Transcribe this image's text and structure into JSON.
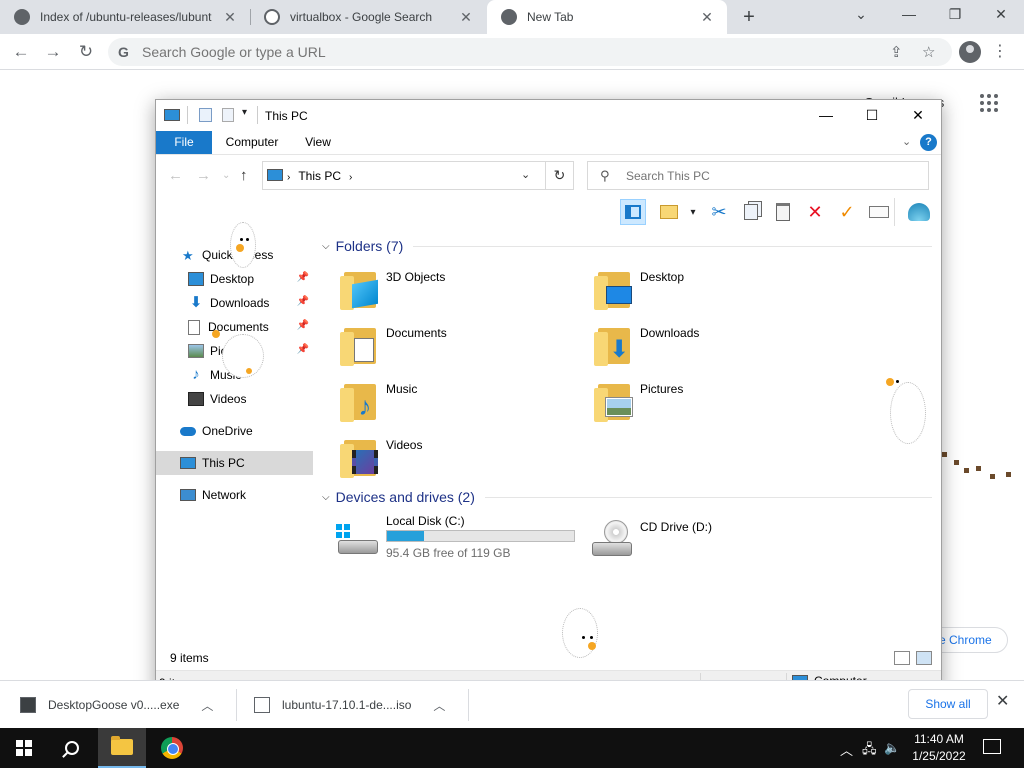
{
  "chrome": {
    "tabs": [
      {
        "title": "Index of /ubuntu-releases/lubuntu"
      },
      {
        "title": "virtualbox - Google Search"
      },
      {
        "title": "New Tab"
      }
    ],
    "omnibox_placeholder": "Search Google or type a URL",
    "ntp_link_text": "Gmail  Images",
    "customize_chrome": "e Chrome"
  },
  "explorer": {
    "title": "This PC",
    "ribbon_tabs": [
      "File",
      "Computer",
      "View"
    ],
    "help": "?",
    "breadcrumb": "This PC",
    "search_placeholder": "Search This PC",
    "nav": {
      "quick_access": "Quick access",
      "desktop": "Desktop",
      "downloads": "Downloads",
      "documents": "Documents",
      "pictures": "Pictures",
      "music": "Music",
      "videos": "Videos",
      "onedrive": "OneDrive",
      "this_pc": "This PC",
      "network": "Network"
    },
    "folders_header": "Folders (7)",
    "folders": [
      "3D Objects",
      "Desktop",
      "Documents",
      "Downloads",
      "Music",
      "Pictures",
      "Videos"
    ],
    "devices_header": "Devices and drives (2)",
    "drives": [
      {
        "name": "Local Disk (C:)",
        "free_text": "95.4 GB free of 119 GB",
        "used_fraction": 0.2
      },
      {
        "name": "CD Drive (D:)"
      }
    ],
    "item_count": "9 items",
    "status_count": "9 items",
    "status_zone": "Computer"
  },
  "downloads": {
    "items": [
      {
        "name": "DesktopGoose v0.....exe"
      },
      {
        "name": "lubuntu-17.10.1-de....iso"
      }
    ],
    "show_all": "Show all"
  },
  "taskbar": {
    "time": "11:40 AM",
    "date": "1/25/2022"
  },
  "colors": {
    "accent": "#1979ca",
    "drive_fill": "#26a0da",
    "folder": "#e8b84a"
  }
}
